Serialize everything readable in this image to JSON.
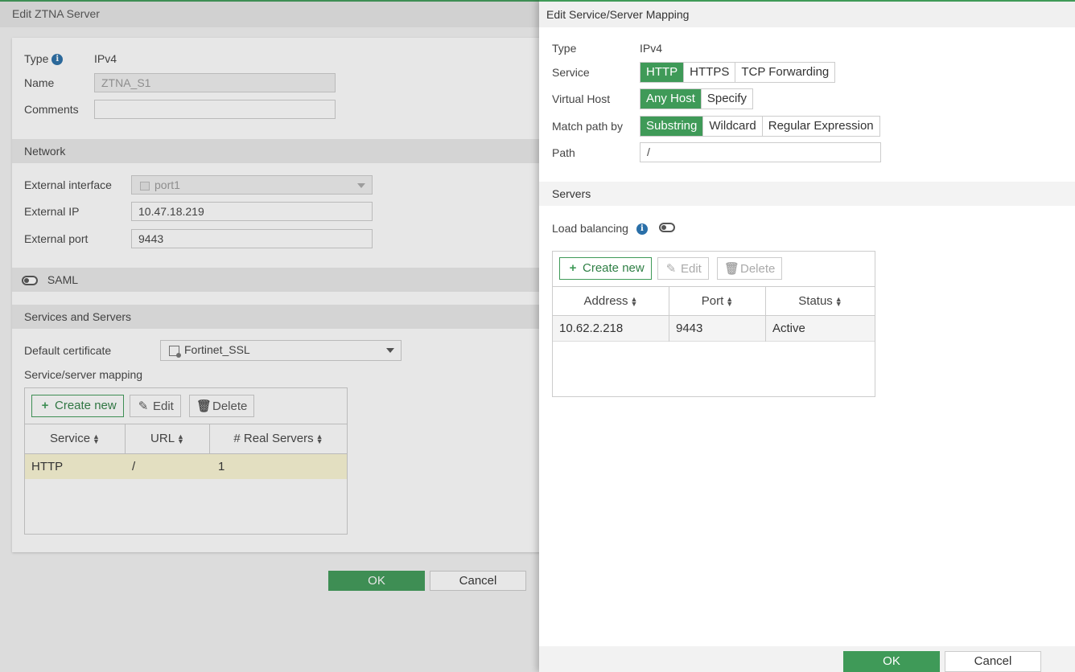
{
  "bg": {
    "title": "Edit ZTNA Server",
    "type_label": "Type",
    "type_value": "IPv4",
    "name_label": "Name",
    "name_value": "ZTNA_S1",
    "comments_label": "Comments",
    "comments_value": "",
    "network_section": "Network",
    "ext_interface_label": "External interface",
    "ext_interface_value": "port1",
    "ext_ip_label": "External IP",
    "ext_ip_value": "10.47.18.219",
    "ext_port_label": "External port",
    "ext_port_value": "9443",
    "saml_label": "SAML",
    "services_section": "Services and Servers",
    "default_cert_label": "Default certificate",
    "default_cert_value": "Fortinet_SSL",
    "mapping_label": "Service/server mapping",
    "toolbar": {
      "create": "Create new",
      "edit": "Edit",
      "delete": "Delete"
    },
    "columns": [
      "Service",
      "URL",
      "# Real Servers"
    ],
    "rows": [
      {
        "service": "HTTP",
        "url": "/",
        "real_servers": "1"
      }
    ],
    "ok": "OK",
    "cancel": "Cancel"
  },
  "panel": {
    "title": "Edit Service/Server Mapping",
    "type_label": "Type",
    "type_value": "IPv4",
    "service_label": "Service",
    "service_options": [
      "HTTP",
      "HTTPS",
      "TCP Forwarding"
    ],
    "service_selected": "HTTP",
    "vhost_label": "Virtual Host",
    "vhost_options": [
      "Any Host",
      "Specify"
    ],
    "vhost_selected": "Any Host",
    "match_label": "Match path by",
    "match_options": [
      "Substring",
      "Wildcard",
      "Regular Expression"
    ],
    "match_selected": "Substring",
    "path_label": "Path",
    "path_value": "/",
    "servers_section": "Servers",
    "lb_label": "Load balancing",
    "lb_enabled": false,
    "toolbar": {
      "create": "Create new",
      "edit": "Edit",
      "delete": "Delete"
    },
    "columns": [
      "Address",
      "Port",
      "Status"
    ],
    "rows": [
      {
        "address": "10.62.2.218",
        "port": "9443",
        "status": "Active"
      }
    ],
    "ok": "OK",
    "cancel": "Cancel"
  },
  "colors": {
    "accent": "#3f9a58",
    "info": "#2a6fa8",
    "row_highlight": "#fbf6d4"
  }
}
